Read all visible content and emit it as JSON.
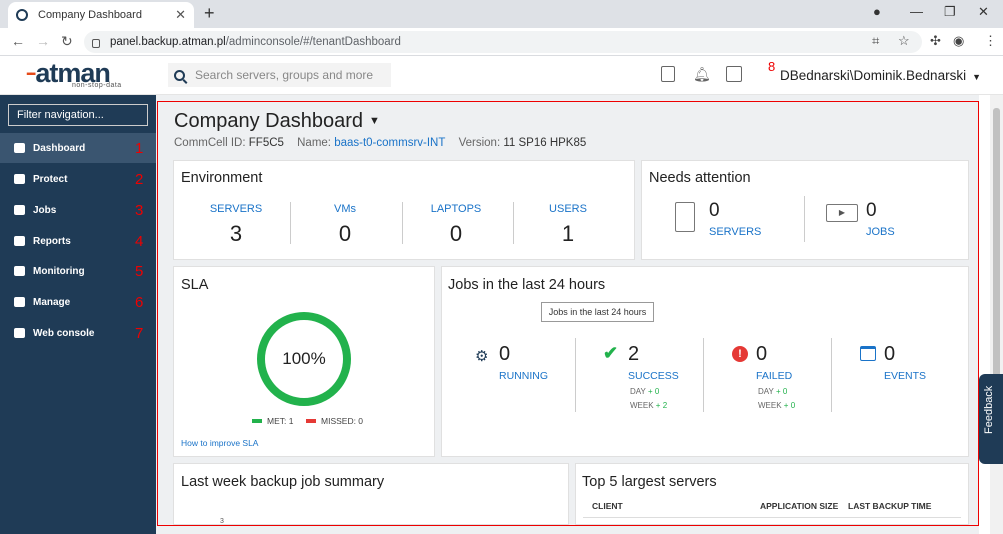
{
  "browser": {
    "tab_title": "Company Dashboard",
    "url_host": "panel.backup.atman.pl",
    "url_path": "/adminconsole/#/tenantDashboard"
  },
  "header": {
    "logo": "atman",
    "logo_tagline": "non-stop-data",
    "search_placeholder": "Search servers, groups and more",
    "user": "DBednarski\\Dominik.Bednarski",
    "user_marker": "8"
  },
  "sidebar": {
    "filter_placeholder": "Filter navigation...",
    "items": [
      {
        "label": "Dashboard",
        "num": "1",
        "icon": "chart-icon"
      },
      {
        "label": "Protect",
        "num": "2",
        "icon": "shield-icon"
      },
      {
        "label": "Jobs",
        "num": "3",
        "icon": "briefcase-icon"
      },
      {
        "label": "Reports",
        "num": "4",
        "icon": "gauge-icon"
      },
      {
        "label": "Monitoring",
        "num": "5",
        "icon": "monitor-icon"
      },
      {
        "label": "Manage",
        "num": "6",
        "icon": "sliders-icon"
      },
      {
        "label": "Web console",
        "num": "7",
        "icon": "globe-icon"
      }
    ]
  },
  "main": {
    "title": "Company Dashboard",
    "commcell_label": "CommCell ID:",
    "commcell_id": "FF5C5",
    "name_label": "Name:",
    "name_value": "baas-t0-commsrv-INT",
    "version_label": "Version:",
    "version_value": "11 SP16 HPK85",
    "environment": {
      "title": "Environment",
      "stats": [
        {
          "label": "SERVERS",
          "value": "3"
        },
        {
          "label": "VMs",
          "value": "0"
        },
        {
          "label": "LAPTOPS",
          "value": "0"
        },
        {
          "label": "USERS",
          "value": "1"
        }
      ]
    },
    "attention": {
      "title": "Needs attention",
      "servers_value": "0",
      "servers_label": "SERVERS",
      "jobs_value": "0",
      "jobs_label": "JOBS"
    },
    "sla": {
      "title": "SLA",
      "percent": "100%",
      "met": "MET: 1",
      "missed": "MISSED: 0",
      "link": "How to improve SLA"
    },
    "jobs24": {
      "title": "Jobs in the last 24 hours",
      "tooltip": "Jobs in the last 24 hours",
      "running_value": "0",
      "running_label": "RUNNING",
      "success_value": "2",
      "success_label": "SUCCESS",
      "success_day": "DAY",
      "success_day_val": "+ 0",
      "success_week": "WEEK",
      "success_week_val": "+ 2",
      "failed_value": "0",
      "failed_label": "FAILED",
      "failed_day": "DAY",
      "failed_day_val": "+ 0",
      "failed_week": "WEEK",
      "failed_week_val": "+ 0",
      "events_value": "0",
      "events_label": "EVENTS"
    },
    "lastweek": {
      "title": "Last week backup job summary",
      "tick": "3"
    },
    "top5": {
      "title": "Top 5 largest servers",
      "col1": "CLIENT",
      "col2": "APPLICATION SIZE",
      "col3": "LAST BACKUP TIME"
    },
    "feedback": "Feedback"
  }
}
